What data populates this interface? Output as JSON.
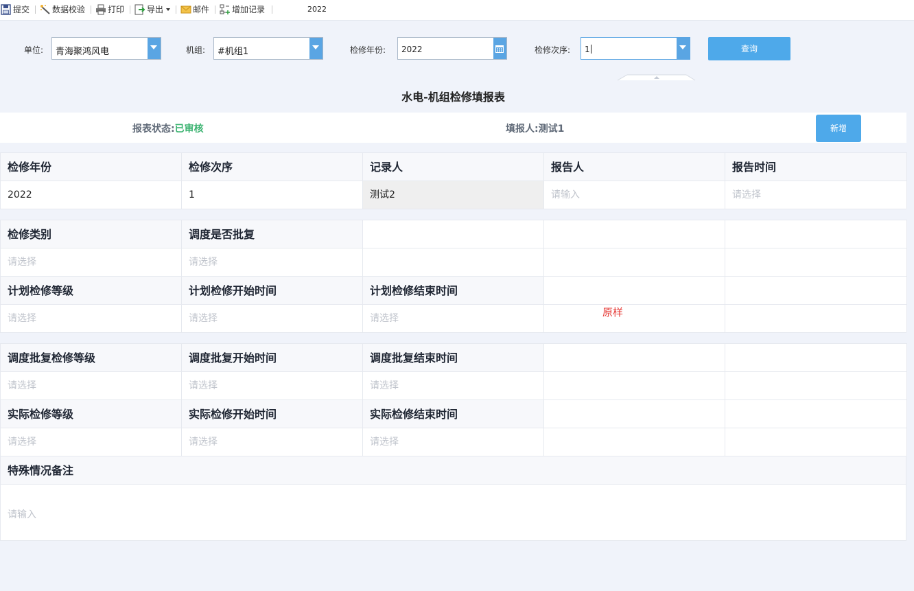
{
  "toolbar": {
    "items": [
      {
        "label": "提交",
        "icon": "save-icon"
      },
      {
        "label": "数据校验",
        "icon": "wand-icon"
      },
      {
        "label": "打印",
        "icon": "printer-icon"
      },
      {
        "label": "导出",
        "icon": "export-icon"
      },
      {
        "label": "邮件",
        "icon": "mail-icon"
      },
      {
        "label": "增加记录",
        "icon": "add-record-icon"
      }
    ],
    "year": "2022"
  },
  "filters": {
    "unit_label": "单位:",
    "unit_value": "青海聚鸿风电",
    "unitset_label": "机组:",
    "unitset_value": "#机组1",
    "year_label": "检修年份:",
    "year_value": "2022",
    "order_label": "检修次序:",
    "order_value": "1",
    "query_label": "查询"
  },
  "report": {
    "title": "水电-机组检修填报表",
    "status_label": "报表状态:",
    "status_value": "已审核",
    "filler_label": "填报人:",
    "filler_value": "测试1",
    "add_label": "新增"
  },
  "section1": {
    "headers": [
      "检修年份",
      "检修次序",
      "记录人",
      "报告人",
      "报告时间"
    ],
    "values": [
      "2022",
      "1",
      "测试2",
      "请输入",
      "请选择"
    ]
  },
  "section2": {
    "row1_headers": [
      "检修类别",
      "调度是否批复"
    ],
    "row1_values": [
      "请选择",
      "请选择"
    ],
    "row2_headers": [
      "计划检修等级",
      "计划检修开始时间",
      "计划检修结束时间"
    ],
    "row2_values": [
      "请选择",
      "请选择",
      "请选择"
    ]
  },
  "section3": {
    "row1_headers": [
      "调度批复检修等级",
      "调度批复开始时间",
      "调度批复结束时间"
    ],
    "row1_values": [
      "请选择",
      "请选择",
      "请选择"
    ],
    "row2_headers": [
      "实际检修等级",
      "实际检修开始时间",
      "实际检修结束时间"
    ],
    "row2_values": [
      "请选择",
      "请选择",
      "请选择"
    ],
    "note_header": "特殊情况备注",
    "note_placeholder": "请输入"
  },
  "annotation": "原样",
  "colors": {
    "accent": "#4ea9ea",
    "status_ok": "#3cb371",
    "annotation": "#e53935"
  }
}
